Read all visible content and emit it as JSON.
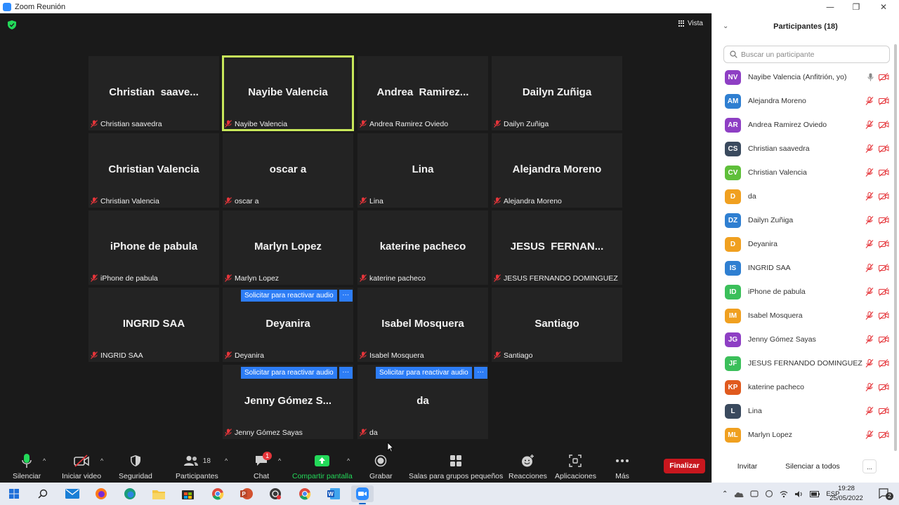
{
  "window": {
    "title": "Zoom Reunión",
    "controls": [
      "—",
      "❐",
      "✕"
    ]
  },
  "view_button": "Vista",
  "tiles": [
    {
      "big": "Christian  saave...",
      "label": "Christian saavedra"
    },
    {
      "big": "Nayibe Valencia",
      "label": "Nayibe Valencia"
    },
    {
      "big": "Andrea  Ramirez...",
      "label": "Andrea Ramirez Oviedo"
    },
    {
      "big": "Dailyn Zuñiga",
      "label": "Dailyn Zuñiga"
    },
    {
      "big": "Christian Valencia",
      "label": "Christian Valencia"
    },
    {
      "big": "oscar a",
      "label": "oscar a"
    },
    {
      "big": "Lina",
      "label": "Lina"
    },
    {
      "big": "Alejandra Moreno",
      "label": "Alejandra Moreno"
    },
    {
      "big": "iPhone de pabula",
      "label": "iPhone de pabula"
    },
    {
      "big": "Marlyn Lopez",
      "label": "Marlyn Lopez"
    },
    {
      "big": "katerine pacheco",
      "label": "katerine pacheco"
    },
    {
      "big": "JESUS  FERNAN...",
      "label": "JESUS FERNANDO DOMINGUEZ"
    },
    {
      "big": "INGRID SAA",
      "label": "INGRID SAA"
    },
    {
      "big": "Deyanira",
      "label": "Deyanira"
    },
    {
      "big": "Isabel Mosquera",
      "label": "Isabel Mosquera"
    },
    {
      "big": "Santiago",
      "label": "Santiago"
    },
    {
      "big": "Jenny Gómez S...",
      "label": "Jenny Gómez Sayas"
    },
    {
      "big": "da",
      "label": "da"
    }
  ],
  "request_audio": {
    "label": "Solicitar para reactivar audio",
    "more": "···"
  },
  "toolbar": {
    "mute": "Silenciar",
    "video": "Iniciar video",
    "security": "Seguridad",
    "participants": "Participantes",
    "participants_count": "18",
    "chat": "Chat",
    "chat_badge": "1",
    "share": "Compartir pantalla",
    "record": "Grabar",
    "breakout": "Salas para grupos pequeños",
    "reactions": "Reacciones",
    "apps": "Aplicaciones",
    "more": "Más",
    "end": "Finalizar"
  },
  "panel": {
    "title": "Participantes (18)",
    "search_placeholder": "Buscar un participante",
    "participants": [
      {
        "initials": "NV",
        "name": "Nayibe Valencia (Anfitrión, yo)",
        "color": "#8e3fc4",
        "mic_on": true
      },
      {
        "initials": "AM",
        "name": "Alejandra Moreno",
        "color": "#2f7fd1"
      },
      {
        "initials": "AR",
        "name": "Andrea Ramirez Oviedo",
        "color": "#8e3fc4"
      },
      {
        "initials": "CS",
        "name": "Christian saavedra",
        "color": "#3a4a5e"
      },
      {
        "initials": "CV",
        "name": "Christian Valencia",
        "color": "#5fbf3a"
      },
      {
        "initials": "D",
        "name": "da",
        "color": "#f0a020"
      },
      {
        "initials": "DZ",
        "name": "Dailyn Zuñiga",
        "color": "#2f7fd1"
      },
      {
        "initials": "D",
        "name": "Deyanira",
        "color": "#f0a020"
      },
      {
        "initials": "IS",
        "name": "INGRID SAA",
        "color": "#2f7fd1"
      },
      {
        "initials": "ID",
        "name": "iPhone de pabula",
        "color": "#3bbf5a"
      },
      {
        "initials": "IM",
        "name": "Isabel Mosquera",
        "color": "#f0a020"
      },
      {
        "initials": "JG",
        "name": "Jenny Gómez Sayas",
        "color": "#8e3fc4"
      },
      {
        "initials": "JF",
        "name": "JESUS FERNANDO DOMINGUEZ",
        "color": "#3bbf5a"
      },
      {
        "initials": "KP",
        "name": "katerine pacheco",
        "color": "#e05a1e"
      },
      {
        "initials": "L",
        "name": "Lina",
        "color": "#3a4a5e"
      },
      {
        "initials": "ML",
        "name": "Marlyn Lopez",
        "color": "#f0a020"
      }
    ],
    "footer": {
      "invite": "Invitar",
      "mute_all": "Silenciar a todos",
      "more": "..."
    }
  },
  "taskbar": {
    "lang": "ESP",
    "time": "19:28",
    "date": "25/05/2022",
    "notification_count": "2"
  }
}
